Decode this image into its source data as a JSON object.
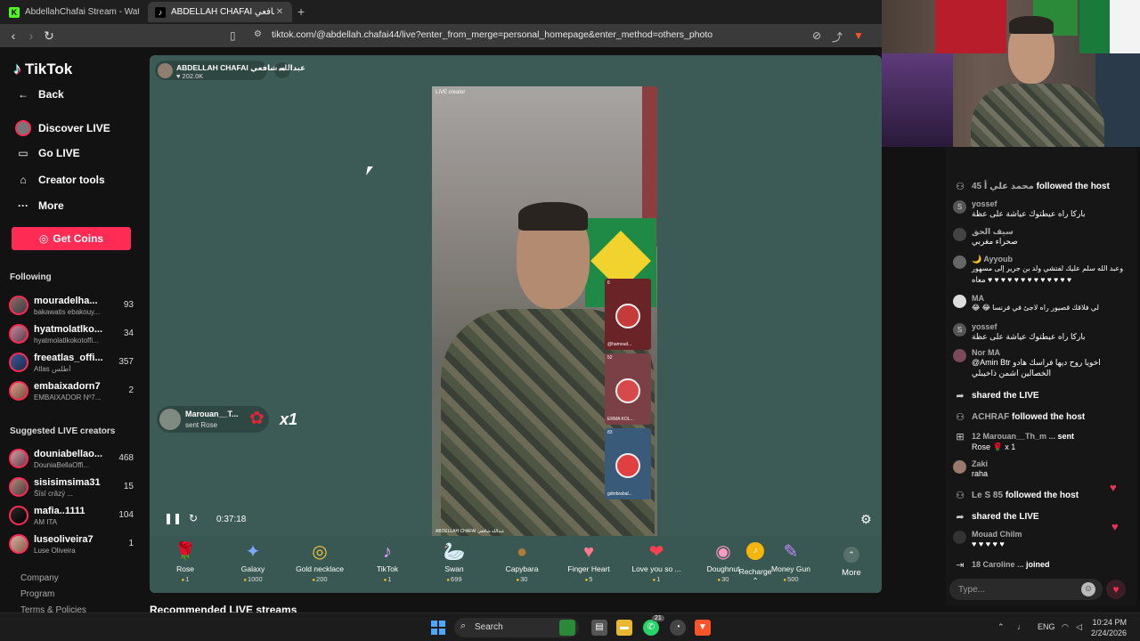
{
  "browser": {
    "tabs": [
      {
        "title": "AbdellahChafai Stream - Watch Live",
        "favicon": "K"
      },
      {
        "title": "ABDELLAH CHAFAI عبدالله شافعي",
        "favicon": "♪"
      }
    ],
    "url": "tiktok.com/@abdellah.chafai44/live?enter_from_merge=personal_homepage&enter_method=others_photo"
  },
  "sidebar": {
    "logo": "TikTok",
    "nav": [
      {
        "label": "Back",
        "icon": "back-arrow-icon"
      },
      {
        "label": "Discover LIVE",
        "icon": "live-avatar-icon"
      },
      {
        "label": "Go LIVE",
        "icon": "camera-icon"
      },
      {
        "label": "Creator tools",
        "icon": "home-tools-icon"
      },
      {
        "label": "More",
        "icon": "more-dots-icon"
      }
    ],
    "get_coins": "Get Coins",
    "following_title": "Following",
    "following": [
      {
        "name": "mouradelha...",
        "sub": "bakawatis ebakouy...",
        "count": "93"
      },
      {
        "name": "hyatmolatlko...",
        "sub": "hyatmolatlkokotoffi...",
        "count": "34"
      },
      {
        "name": "freeatlas_offi...",
        "sub": "Atlas أطلس",
        "count": "357"
      },
      {
        "name": "embaixadorn7",
        "sub": "EMBAIXADOR Nº7...",
        "count": "2"
      }
    ],
    "suggested_title": "Suggested LIVE creators",
    "suggested": [
      {
        "name": "douniabellao...",
        "sub": "DouniaBellaOffi...",
        "count": "468"
      },
      {
        "name": "sisisimsima31",
        "sub": "Šîsî crâzÿ ...",
        "count": "15"
      },
      {
        "name": "mafia..1111",
        "sub": "AM ITA",
        "count": "104"
      },
      {
        "name": "luseoliveira7",
        "sub": "Luse Oliveira",
        "count": "1"
      }
    ],
    "footer": [
      "Company",
      "Program",
      "Terms & Policies"
    ]
  },
  "player": {
    "host_name": "ABDELLAH CHAFAI عبدالله شافعي",
    "host_likes": "♥ 202.0K",
    "live_creator_tag": "LIVE creator",
    "stream_caption": "ABDELLAH CHAFAI عبدالله شافعي",
    "guests": [
      {
        "tag": "6",
        "name": "@hamoud..."
      },
      {
        "tag": "52",
        "name": "ERMA KOL..."
      },
      {
        "tag": "83",
        "name": "gdmbrabal..."
      }
    ],
    "gift_popup": {
      "user": "Marouan__T...",
      "action": "sent Rose",
      "multiplier": "x1"
    },
    "time": "0:37:18",
    "volume_level": 0.1
  },
  "gifts": [
    {
      "name": "Rose",
      "price": "1",
      "icon": "🌹"
    },
    {
      "name": "Galaxy",
      "price": "1000",
      "icon": "✦"
    },
    {
      "name": "Gold necklace",
      "price": "200",
      "icon": "◎"
    },
    {
      "name": "TikTok",
      "price": "1",
      "icon": "♪"
    },
    {
      "name": "Swan",
      "price": "699",
      "icon": "🦢"
    },
    {
      "name": "Capybara",
      "price": "30",
      "icon": "●"
    },
    {
      "name": "Finger Heart",
      "price": "5",
      "icon": "♥"
    },
    {
      "name": "Love you so ...",
      "price": "1",
      "icon": "❤"
    },
    {
      "name": "Doughnut",
      "price": "30",
      "icon": "◉"
    },
    {
      "name": "Money Gun",
      "price": "500",
      "icon": "✎"
    }
  ],
  "more_label": "More",
  "recharge_label": "Recharge ⌃",
  "recommended_title": "Recommended LIVE streams",
  "chat": {
    "messages": [
      {
        "type": "info",
        "user": "45 محمد علي أ",
        "text": "followed the host"
      },
      {
        "type": "msg",
        "user": "yossef",
        "text": "باركا راه عيطتوك عياشة على عظة",
        "avatar": "S"
      },
      {
        "type": "msg",
        "user": "سيف الحق",
        "text": "صحراء مغربي",
        "avatar": ""
      },
      {
        "type": "msg",
        "user": "🌙 Ayyoub",
        "text": "وعبد الله سلم عليك لفتشي ولد بن جرير إلى مسهور",
        "text2": "معاه ♥ ♥ ♥ ♥ ♥ ♥ ♥ ♥ ♥ ♥ ♥ ♥ ♥",
        "avatar": ""
      },
      {
        "type": "msg",
        "user": "MA",
        "text": "😂 😂 لي فلاقك قصيور راه لاجئ في فرنسا",
        "avatar": ""
      },
      {
        "type": "msg",
        "user": "yossef",
        "text": "باركا راه عيطتوك عياشة على عظة",
        "avatar": "S"
      },
      {
        "type": "msg",
        "user": "Nor MA",
        "text": "@Amin Btr اخويا روح ديها فراسك هادو",
        "text2": "الخصالين اشمن ذاخيبلي",
        "avatar": ""
      },
      {
        "type": "info",
        "user": "",
        "text": "shared the LIVE"
      },
      {
        "type": "info",
        "user": "ACHRAF",
        "text": "followed the host"
      },
      {
        "type": "gift",
        "user": "12 Marouan__Th_m ...",
        "text": "sent",
        "text2": "Rose 🌹 x 1"
      },
      {
        "type": "msg",
        "user": "Zaki",
        "text": "raha",
        "avatar": ""
      },
      {
        "type": "info",
        "user": "Le S 85",
        "text": "followed the host"
      },
      {
        "type": "info",
        "user": "",
        "text": "shared the LIVE"
      },
      {
        "type": "msg",
        "user": "Mouad Chilm",
        "text": "♥ ♥ ♥ ♥ ♥",
        "avatar": ""
      },
      {
        "type": "info",
        "user": "18 Caroline ...",
        "text": "joined"
      }
    ],
    "input_placeholder": "Type..."
  },
  "taskbar": {
    "search_label": "Search",
    "lang": "ENG",
    "time": "10:24 PM",
    "date": "2/24/2026",
    "badge": "21"
  }
}
